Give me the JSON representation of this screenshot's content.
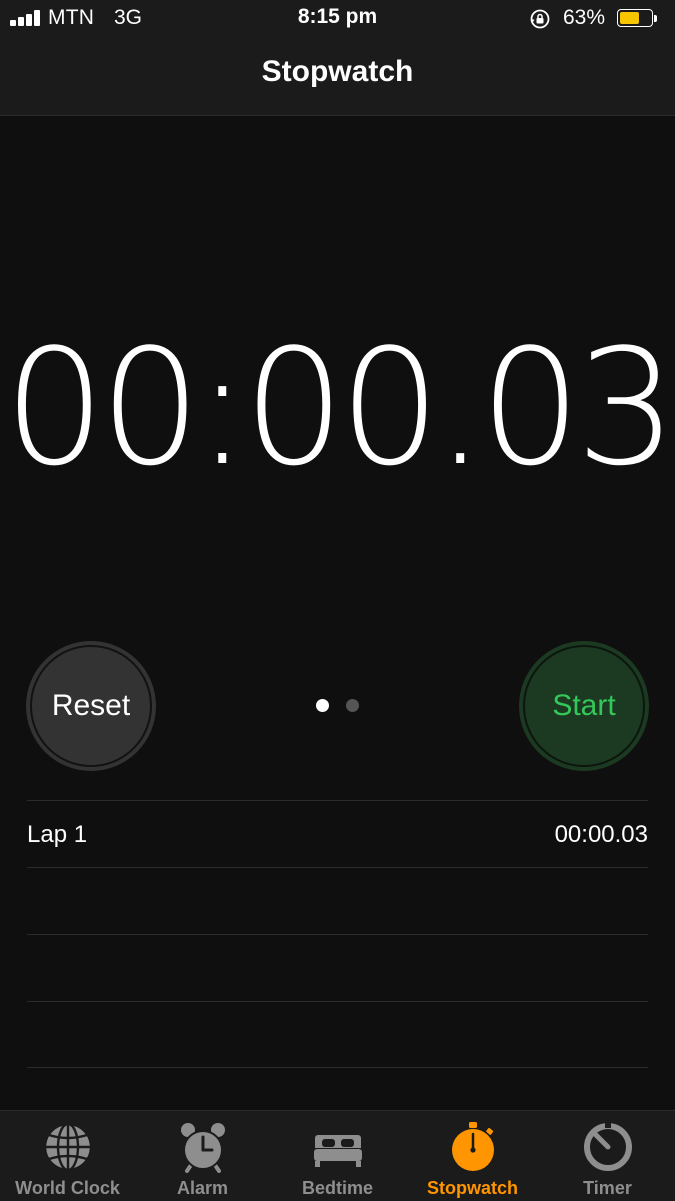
{
  "status_bar": {
    "carrier": "MTN",
    "network": "3G",
    "time": "8:15 pm",
    "battery_percent": "63%",
    "battery_level": 0.63,
    "battery_color": "#f7c600",
    "signal_bars": 4
  },
  "header": {
    "title": "Stopwatch"
  },
  "stopwatch": {
    "display": "00:00.03"
  },
  "controls": {
    "reset_label": "Reset",
    "start_label": "Start",
    "start_color": "#34c759",
    "page_dots": 2,
    "active_page": 1
  },
  "laps": [
    {
      "label": "Lap 1",
      "time": "00:00.03"
    },
    {
      "label": "",
      "time": ""
    },
    {
      "label": "",
      "time": ""
    },
    {
      "label": "",
      "time": ""
    }
  ],
  "tabbar": {
    "active_color": "#ff9500",
    "items": [
      {
        "label": "World Clock",
        "icon": "globe-icon",
        "active": false
      },
      {
        "label": "Alarm",
        "icon": "alarm-clock-icon",
        "active": false
      },
      {
        "label": "Bedtime",
        "icon": "bed-icon",
        "active": false
      },
      {
        "label": "Stopwatch",
        "icon": "stopwatch-icon",
        "active": true
      },
      {
        "label": "Timer",
        "icon": "timer-icon",
        "active": false
      }
    ]
  }
}
